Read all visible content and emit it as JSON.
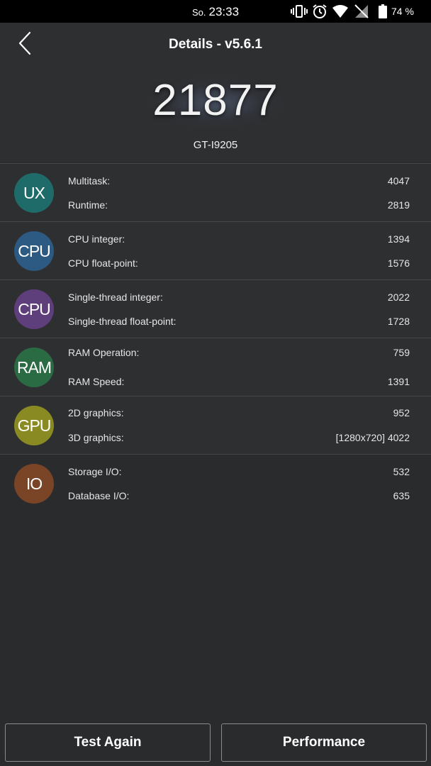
{
  "status_bar": {
    "day": "So.",
    "time": "23:33",
    "battery": "74 %",
    "icons": [
      "vibrate-icon",
      "alarm-icon",
      "wifi-icon",
      "no-signal-icon",
      "battery-icon"
    ]
  },
  "header": {
    "title": "Details - v5.6.1",
    "back_icon": "chevron-left-icon",
    "total_score": "21877",
    "device": "GT-I9205"
  },
  "categories": [
    {
      "badge": "UX",
      "color": "#1f6b6a",
      "metrics": [
        {
          "label": "Multitask:",
          "value": "4047"
        },
        {
          "label": "Runtime:",
          "value": "2819"
        }
      ]
    },
    {
      "badge": "CPU",
      "color": "#2d5a82",
      "metrics": [
        {
          "label": "CPU integer:",
          "value": "1394"
        },
        {
          "label": "CPU float-point:",
          "value": "1576"
        }
      ]
    },
    {
      "badge": "CPU",
      "color": "#5e3f7c",
      "metrics": [
        {
          "label": "Single-thread integer:",
          "value": "2022"
        },
        {
          "label": "Single-thread float-point:",
          "value": "1728"
        }
      ]
    },
    {
      "badge": "RAM",
      "color": "#2b6b44",
      "metrics": [
        {
          "label": "RAM Operation:",
          "value": "759"
        },
        {
          "label": "RAM Speed:",
          "value": "1391"
        }
      ]
    },
    {
      "badge": "GPU",
      "color": "#8a8a22",
      "metrics": [
        {
          "label": "2D graphics:",
          "value": "952"
        },
        {
          "label": "3D graphics:",
          "value": "[1280x720] 4022"
        }
      ]
    },
    {
      "badge": "IO",
      "color": "#7a4527",
      "metrics": [
        {
          "label": "Storage I/O:",
          "value": "532"
        },
        {
          "label": "Database I/O:",
          "value": "635"
        }
      ]
    }
  ],
  "footer": {
    "test_again": "Test Again",
    "performance": "Performance"
  }
}
